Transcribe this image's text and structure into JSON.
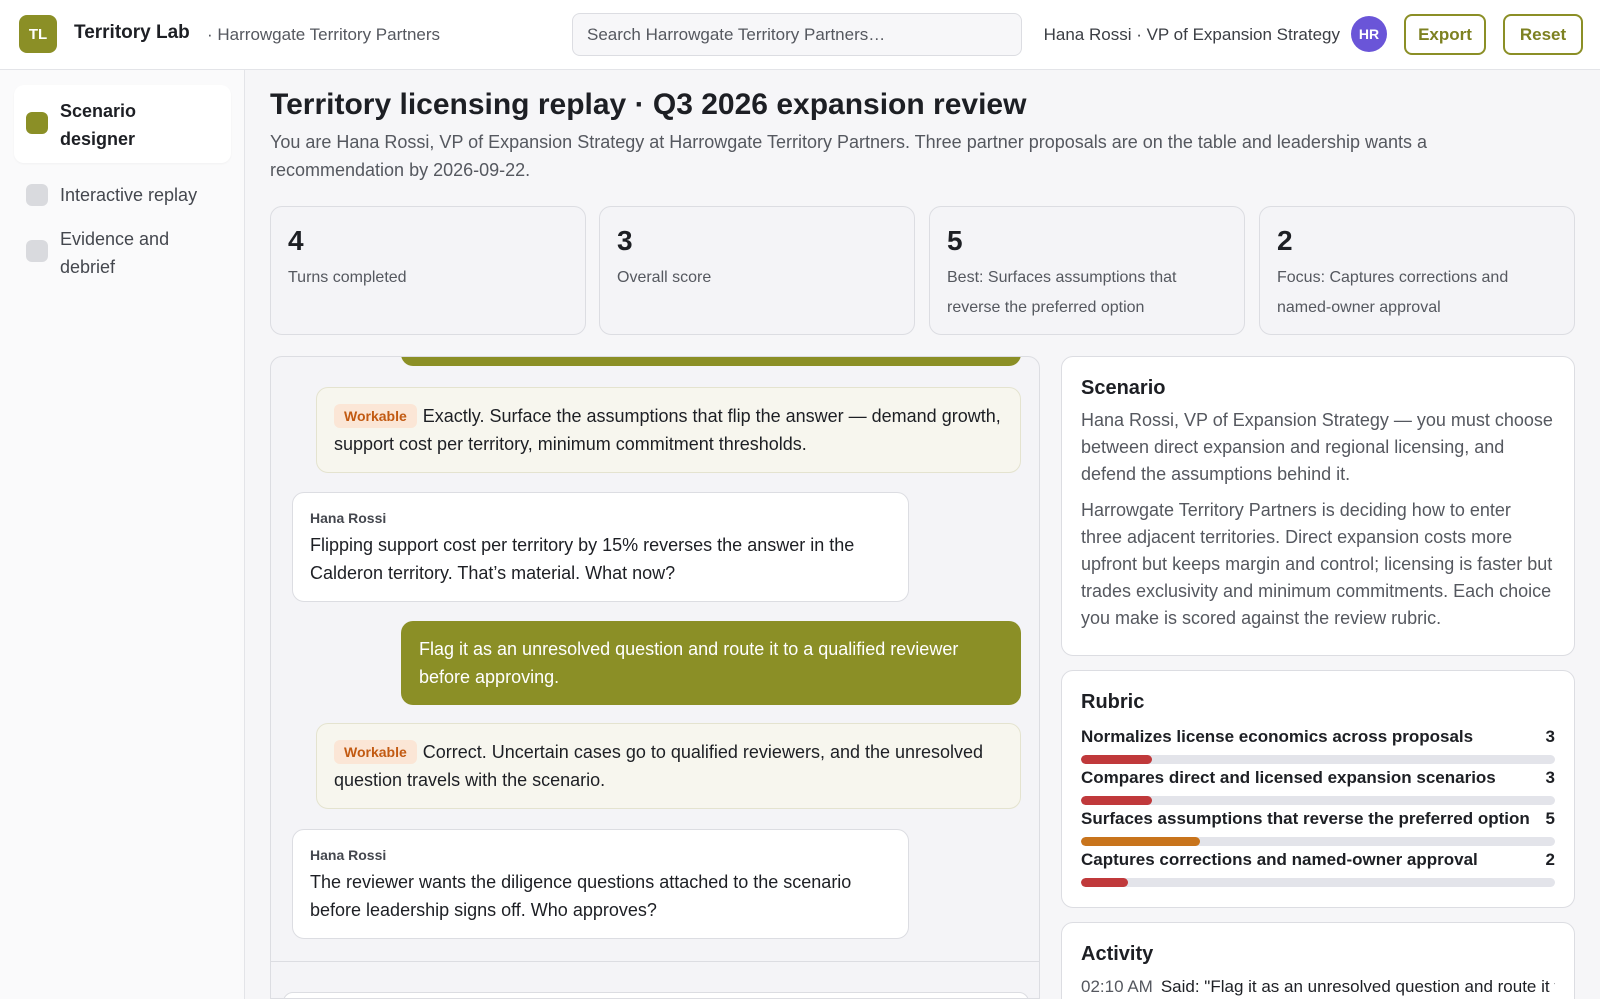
{
  "header": {
    "logo_text": "TL",
    "app_title": "Territory Lab",
    "org_crumb": "· Harrowgate Territory Partners",
    "search_placeholder": "Search Harrowgate Territory Partners…",
    "user_label": "Hana Rossi · VP of Expansion Strategy",
    "avatar_initials": "HR",
    "export_label": "Export",
    "reset_label": "Reset"
  },
  "sidebar": {
    "items": [
      {
        "label": "Scenario designer",
        "active": true
      },
      {
        "label": "Interactive replay",
        "active": false
      },
      {
        "label": "Evidence and debrief",
        "active": false
      }
    ]
  },
  "main": {
    "title": "Territory licensing replay · Q3 2026 expansion review",
    "subtitle": "You are Hana Rossi, VP of Expansion Strategy at Harrowgate Territory Partners. Three partner proposals are on the table and leadership wants a recommendation by 2026-09-22.",
    "stats": [
      {
        "value": "4",
        "label": "Turns completed"
      },
      {
        "value": "3",
        "label": "Overall score"
      },
      {
        "value": "5",
        "label": "Best: Surfaces assumptions that reverse the preferred option"
      },
      {
        "value": "2",
        "label": "Focus: Captures corrections and named-owner approval"
      }
    ]
  },
  "transcript": {
    "messages": [
      {
        "role": "coach",
        "badge": "Workable",
        "text": "Exactly. Surface the assumptions that flip the answer — demand growth, support cost per territory, minimum commitment thresholds."
      },
      {
        "role": "npc",
        "name": "Hana Rossi",
        "text": "Flipping support cost per territory by 15% reverses the answer in the Calderon territory. That’s material. What now?"
      },
      {
        "role": "user",
        "text": "Flag it as an unresolved question and route it to a qualified reviewer before approving."
      },
      {
        "role": "coach",
        "badge": "Workable",
        "text": "Correct. Uncertain cases go to qualified reviewers, and the unresolved question travels with the scenario."
      },
      {
        "role": "npc",
        "name": "Hana Rossi",
        "text": "The reviewer wants the diligence questions attached to the scenario before leadership signs off. Who approves?"
      }
    ]
  },
  "scenario": {
    "heading": "Scenario",
    "intro": "Hana Rossi, VP of Expansion Strategy — you must choose between direct expansion and regional licensing, and defend the assumptions behind it.",
    "body": "Harrowgate Territory Partners is deciding how to enter three adjacent territories. Direct expansion costs more upfront but keeps margin and control; licensing is faster but trades exclusivity and minimum commitments. Each choice you make is scored against the review rubric."
  },
  "rubric": {
    "heading": "Rubric",
    "max_score": 20,
    "items": [
      {
        "label": "Normalizes license economics across proposals",
        "score": 3,
        "color": "#c0393b"
      },
      {
        "label": "Compares direct and licensed expansion scenarios",
        "score": 3,
        "color": "#c0393b"
      },
      {
        "label": "Surfaces assumptions that reverse the preferred option",
        "score": 5,
        "color": "#c8741c"
      },
      {
        "label": "Captures corrections and named-owner approval",
        "score": 2,
        "color": "#c0393b"
      }
    ]
  },
  "activity": {
    "heading": "Activity",
    "items": [
      {
        "time": "02:10 AM",
        "text": "Said: \"Flag it as an unresolved question and route it to a qualified reviewer before approving.\""
      }
    ]
  },
  "colors": {
    "accent": "#8b8f26",
    "avatar": "#6a55d8",
    "badge_bg": "#fbe6d6",
    "badge_text": "#c25a12"
  }
}
